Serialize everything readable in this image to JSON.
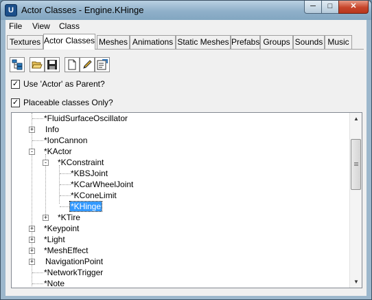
{
  "window": {
    "title": "Actor Classes - Engine.KHinge",
    "app_icon_letter": "U",
    "minimize_icon": "minimize-icon",
    "maximize_icon": "maximize-icon",
    "close_icon": "close-icon"
  },
  "menubar": [
    "File",
    "View",
    "Class"
  ],
  "tabs": [
    "Textures",
    "Actor Classes",
    "Meshes",
    "Animations",
    "Static Meshes",
    "Prefabs",
    "Groups",
    "Sounds",
    "Music"
  ],
  "active_tab": "Actor Classes",
  "toolbar": [
    {
      "name": "class-tree-button",
      "icon": "class-tree-icon"
    },
    {
      "name": "open-package-button",
      "icon": "open-folder-icon"
    },
    {
      "name": "save-package-button",
      "icon": "save-disk-icon"
    },
    {
      "name": "new-class-button",
      "icon": "new-document-icon"
    },
    {
      "name": "edit-script-button",
      "icon": "pencil-icon"
    },
    {
      "name": "default-properties-button",
      "icon": "properties-icon"
    }
  ],
  "options": {
    "use_actor_as_parent": {
      "label": "Use 'Actor' as Parent?",
      "checked": true
    },
    "placeable_only": {
      "label": "Placeable classes Only?",
      "checked": true
    }
  },
  "tree": {
    "nodes": [
      {
        "label": "*FluidSurfaceOscillator",
        "depth": 0,
        "expander": "none"
      },
      {
        "label": "Info",
        "depth": 0,
        "expander": "+"
      },
      {
        "label": "*IonCannon",
        "depth": 0,
        "expander": "none"
      },
      {
        "label": "*KActor",
        "depth": 0,
        "expander": "-"
      },
      {
        "label": "*KConstraint",
        "depth": 1,
        "expander": "-"
      },
      {
        "label": "*KBSJoint",
        "depth": 2,
        "expander": "none"
      },
      {
        "label": "*KCarWheelJoint",
        "depth": 2,
        "expander": "none"
      },
      {
        "label": "*KConeLimit",
        "depth": 2,
        "expander": "none"
      },
      {
        "label": "*KHinge",
        "depth": 2,
        "expander": "none",
        "selected": true
      },
      {
        "label": "*KTire",
        "depth": 1,
        "expander": "+"
      },
      {
        "label": "*Keypoint",
        "depth": 0,
        "expander": "+"
      },
      {
        "label": "*Light",
        "depth": 0,
        "expander": "+"
      },
      {
        "label": "*MeshEffect",
        "depth": 0,
        "expander": "+"
      },
      {
        "label": "NavigationPoint",
        "depth": 0,
        "expander": "+"
      },
      {
        "label": "*NetworkTrigger",
        "depth": 0,
        "expander": "none"
      },
      {
        "label": "*Note",
        "depth": 0,
        "expander": "none"
      }
    ],
    "scroll_up_icon": "scroll-up-arrow-icon",
    "scroll_down_icon": "scroll-down-arrow-icon"
  },
  "colors": {
    "selection": "#3399ff",
    "chrome": "#9cb7cc",
    "client": "#f0f0f0",
    "close_button": "#c7452a"
  }
}
